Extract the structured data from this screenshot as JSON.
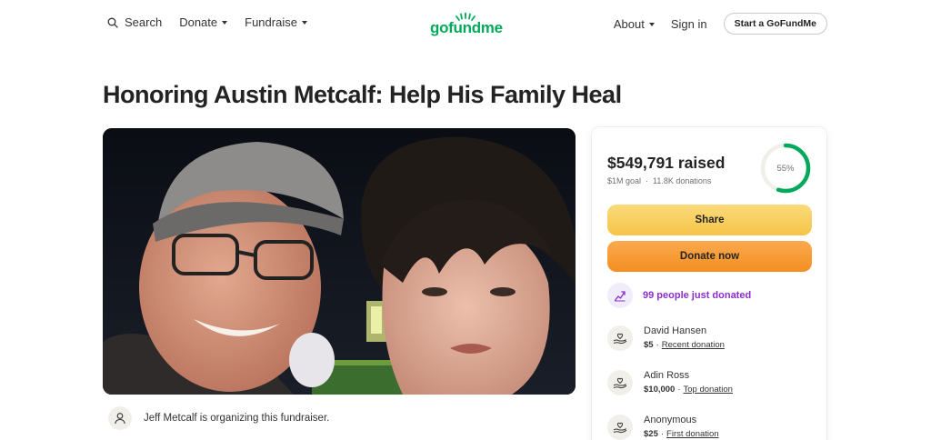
{
  "header": {
    "search_label": "Search",
    "donate_label": "Donate",
    "fundraise_label": "Fundraise",
    "logo_text": "gofundme",
    "about_label": "About",
    "signin_label": "Sign in",
    "start_label": "Start a GoFundMe"
  },
  "page": {
    "title": "Honoring Austin Metcalf: Help His Family Heal"
  },
  "organizer": {
    "text": "Jeff Metcalf is organizing this fundraiser."
  },
  "card": {
    "raised": "$549,791 raised",
    "goal": "$1M goal",
    "donations": "11.8K donations",
    "progress_label": "55%",
    "progress_fraction": 0.55,
    "share_label": "Share",
    "donate_label": "Donate now",
    "recent_activity": "99 people just donated",
    "donors": [
      {
        "name": "David Hansen",
        "amount": "$5",
        "tag": "Recent donation"
      },
      {
        "name": "Adin Ross",
        "amount": "$10,000",
        "tag": "Top donation"
      },
      {
        "name": "Anonymous",
        "amount": "$25",
        "tag": "First donation"
      }
    ]
  },
  "colors": {
    "brand": "#02a95c",
    "share_button": "#f6c448",
    "donate_button": "#f48f21",
    "activity_purple": "#8b2fc9"
  }
}
